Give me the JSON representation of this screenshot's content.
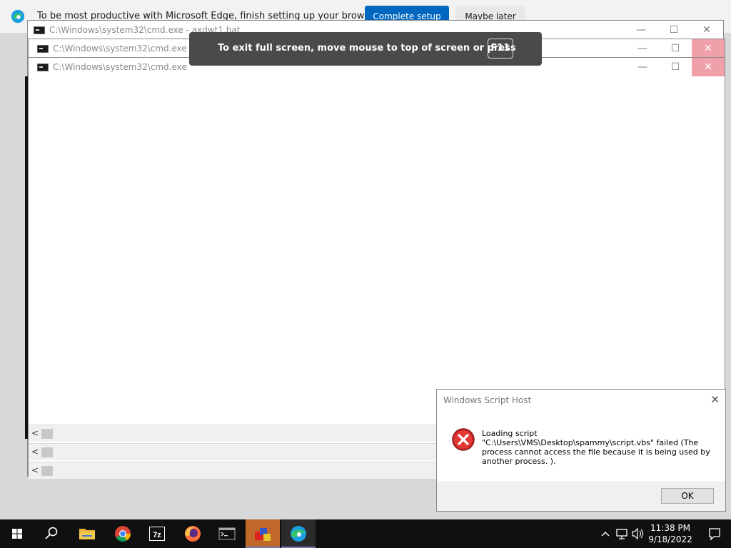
{
  "edge_infobar": {
    "message": "To be most productive with Microsoft Edge, finish setting up your browser",
    "complete_setup_label": "Complete setup",
    "maybe_later_label": "Maybe later",
    "brand_color": "#0067c0"
  },
  "cmd_windows": [
    {
      "title": "C:\\Windows\\system32\\cmd.exe - axdwt1.bat"
    },
    {
      "title": "C:\\Windows\\system32\\cmd.exe"
    },
    {
      "title": "C:\\Windows\\system32\\cmd.exe"
    }
  ],
  "window_controls": {
    "minimize": "—",
    "maximize": "☐",
    "close": "✕"
  },
  "scroll_arrow": "<",
  "fullscreen_toast": {
    "message": "To exit full screen, move mouse to top of screen or press",
    "key": "F11"
  },
  "wsh_dialog": {
    "title": "Windows Script Host",
    "close_glyph": "✕",
    "message_lines": [
      "Loading script",
      "\"C:\\Users\\VMS\\Desktop\\spammy\\script.vbs\" failed (The",
      "process cannot access the file because it is being used by",
      "another process. )."
    ],
    "ok_label": "OK",
    "icon": "error-icon",
    "icon_color": "#d32f2f"
  },
  "taskbar": {
    "apps": [
      "start",
      "search",
      "file-explorer",
      "chrome",
      "7zip",
      "firefox",
      "cmd",
      "package-app",
      "edge"
    ],
    "zip_label": "7z",
    "clock_time": "11:38 PM",
    "clock_date": "9/18/2022"
  }
}
